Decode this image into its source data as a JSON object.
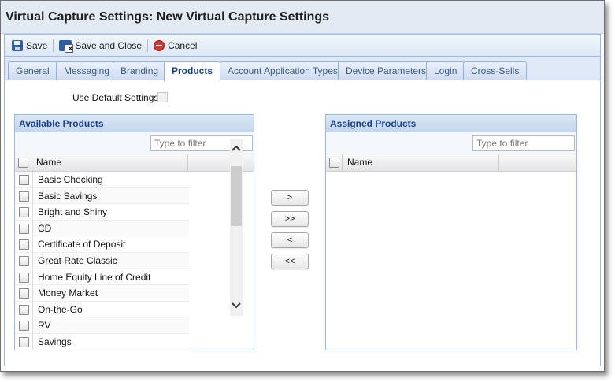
{
  "window": {
    "title": "Virtual Capture Settings: New Virtual Capture Settings"
  },
  "toolbar": {
    "save_label": "Save",
    "save_close_label": "Save and Close",
    "cancel_label": "Cancel"
  },
  "tabs": [
    {
      "label": "General",
      "active": false
    },
    {
      "label": "Messaging",
      "active": false
    },
    {
      "label": "Branding",
      "active": false
    },
    {
      "label": "Products",
      "active": true
    },
    {
      "label": "Account Application Types",
      "active": false
    },
    {
      "label": "Device Parameters",
      "active": false
    },
    {
      "label": "Login",
      "active": false
    },
    {
      "label": "Cross-Sells",
      "active": false
    }
  ],
  "settings": {
    "use_default_label": "Use Default Settings:",
    "use_default_checked": false
  },
  "available": {
    "title": "Available Products",
    "filter_placeholder": "Type to filter",
    "column_name": "Name",
    "items": [
      "Basic Checking",
      "Basic Savings",
      "Bright and Shiny",
      "CD",
      "Certificate of Deposit",
      "Great Rate Classic",
      "Home Equity Line of Credit",
      "Money Market",
      "On-the-Go",
      "RV",
      "Savings"
    ]
  },
  "assigned": {
    "title": "Assigned Products",
    "filter_placeholder": "Type to filter",
    "column_name": "Name",
    "items": []
  },
  "move_buttons": {
    "add": ">",
    "add_all": ">>",
    "remove": "<",
    "remove_all": "<<"
  },
  "colors": {
    "panel_border": "#99bbe8",
    "header_text": "#15428b",
    "cancel_red": "#d8372e"
  }
}
